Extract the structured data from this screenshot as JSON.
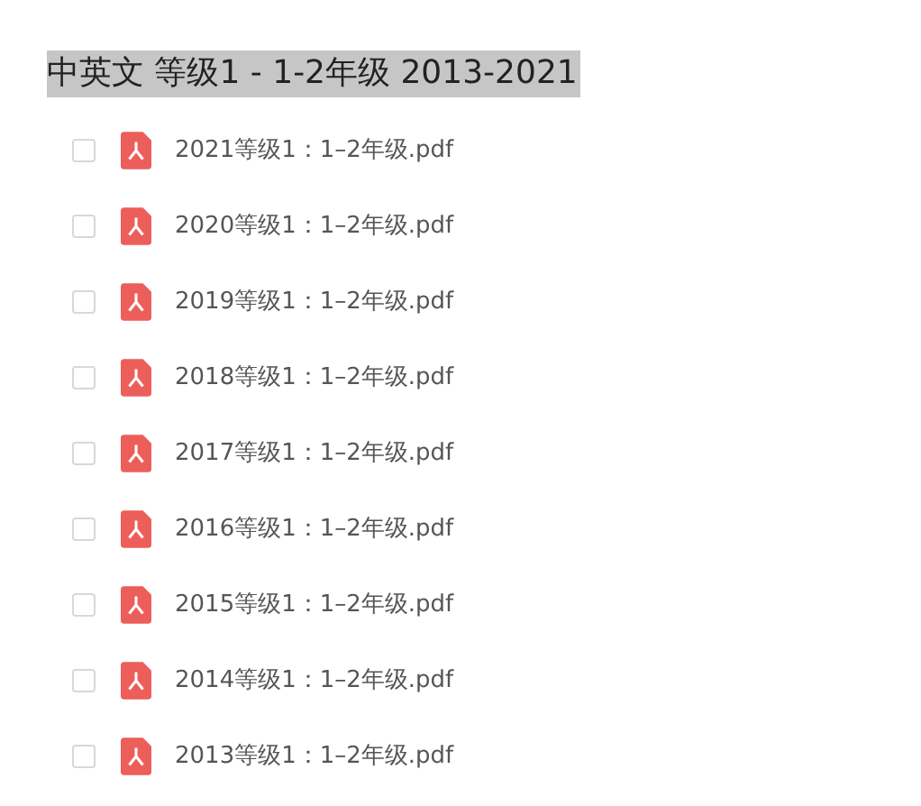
{
  "title": "中英文 等级1 - 1-2年级 2013-2021",
  "files": [
    {
      "name": "2021等级1：1–2年级.pdf",
      "checked": false
    },
    {
      "name": "2020等级1：1–2年级.pdf",
      "checked": false
    },
    {
      "name": "2019等级1：1–2年级.pdf",
      "checked": false
    },
    {
      "name": "2018等级1：1–2年级.pdf",
      "checked": false
    },
    {
      "name": "2017等级1：1–2年级.pdf",
      "checked": false
    },
    {
      "name": "2016等级1：1–2年级.pdf",
      "checked": false
    },
    {
      "name": "2015等级1：1–2年级.pdf",
      "checked": false
    },
    {
      "name": "2014等级1：1–2年级.pdf",
      "checked": false
    },
    {
      "name": "2013等级1：1–2年级.pdf",
      "checked": false
    }
  ]
}
